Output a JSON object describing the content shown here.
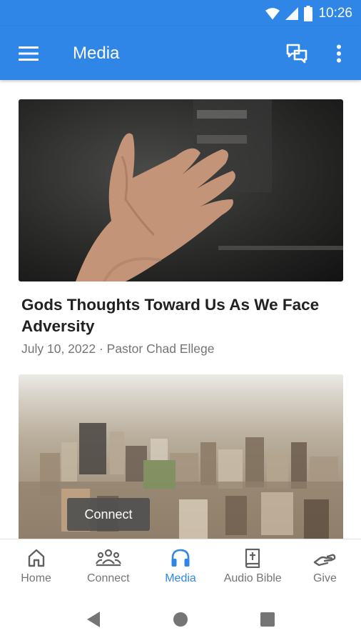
{
  "status_bar": {
    "time": "10:26"
  },
  "app_bar": {
    "title": "Media"
  },
  "cards": [
    {
      "title": "Gods Thoughts Toward Us As We Face Adversity",
      "meta": "July 10, 2022 · Pastor Chad Ellege"
    }
  ],
  "snackbar": {
    "text": "Connect"
  },
  "bottom_nav": {
    "items": [
      {
        "label": "Home",
        "icon": "home-icon"
      },
      {
        "label": "Connect",
        "icon": "people-icon"
      },
      {
        "label": "Media",
        "icon": "headphones-icon",
        "active": true
      },
      {
        "label": "Audio Bible",
        "icon": "bible-icon"
      },
      {
        "label": "Give",
        "icon": "give-hand-icon"
      }
    ]
  },
  "colors": {
    "primary": "#2f86e6",
    "inactive": "#757575",
    "text": "#212121"
  }
}
